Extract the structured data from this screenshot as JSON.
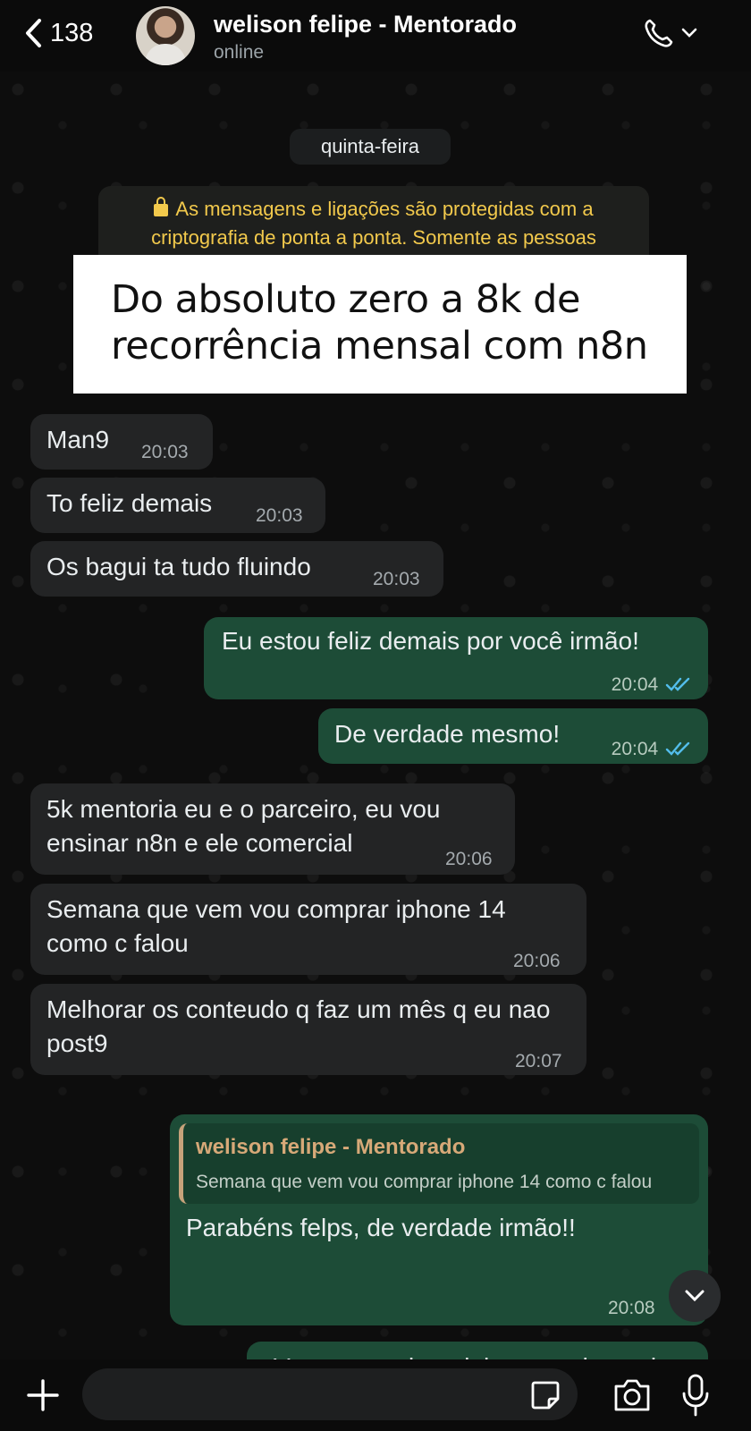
{
  "header": {
    "back_count": "138",
    "contact_name": "welison felipe - Mentorado",
    "status": "online"
  },
  "chat": {
    "date_label": "quinta-feira",
    "encryption_notice": "As mensagens e ligações são protegidas com a criptografia de ponta a ponta. Somente as pessoas",
    "overlay_caption_line1": "Do absoluto zero a 8k de",
    "overlay_caption_line2": "recorrência mensal com n8n",
    "messages": [
      {
        "direction": "in",
        "text": "Man9",
        "time": "20:03"
      },
      {
        "direction": "in",
        "text": "To feliz demais",
        "time": "20:03"
      },
      {
        "direction": "in",
        "text": "Os bagui ta tudo fluindo",
        "time": "20:03"
      },
      {
        "direction": "out",
        "text": "Eu estou feliz demais por você irmão!",
        "time": "20:04"
      },
      {
        "direction": "out",
        "text": "De verdade mesmo!",
        "time": "20:04"
      },
      {
        "direction": "in",
        "text": "5k mentoria eu e o parceiro, eu vou ensinar n8n e ele comercial",
        "time": "20:06"
      },
      {
        "direction": "in",
        "text": "Semana que vem vou comprar iphone 14 como c falou",
        "time": "20:06"
      },
      {
        "direction": "in",
        "text": "Melhorar os conteudo q faz um mês q eu nao post9",
        "time": "20:07"
      },
      {
        "direction": "out",
        "reply_to_name": "welison felipe - Mentorado",
        "reply_to_text": "Semana que vem vou comprar iphone 14 como c falou",
        "text": "Parabéns felps, de verdade irmão!!",
        "time": "20:08"
      },
      {
        "direction": "out",
        "text": "Vou te mandar minha agenda aqui",
        "time": ""
      }
    ]
  },
  "composer": {
    "placeholder": ""
  },
  "colors": {
    "incoming_bubble": "#232425",
    "outgoing_bubble": "#1d4c37",
    "read_ticks": "#53bdeb",
    "encryption_text": "#f2c94c"
  },
  "icons": [
    "chevron-left-icon",
    "phone-icon",
    "chevron-down-icon",
    "lock-icon",
    "double-check-icon",
    "plus-icon",
    "sticker-icon",
    "camera-icon",
    "microphone-icon"
  ]
}
